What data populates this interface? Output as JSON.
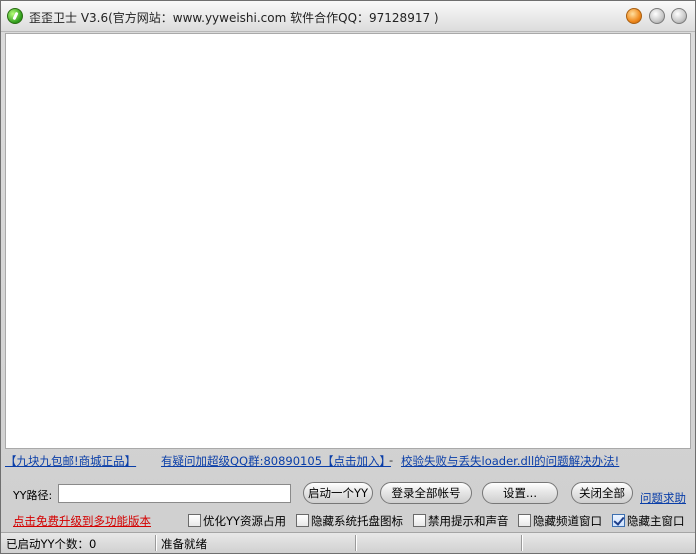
{
  "window": {
    "title": "歪歪卫士 V3.6(官方网站：www.yyweishi.com 软件合作QQ：97128917 )"
  },
  "links": {
    "promo": "【九块九包邮!商城正品】",
    "qq_group": "有疑问加超级QQ群:80890105【点击加入】",
    "dash": "-",
    "fix": "校验失败与丢失loader.dll的问题解决办法!",
    "help": "问题求助",
    "upgrade": "点击免费升级到多功能版本"
  },
  "path": {
    "label": "YY路径:",
    "value": ""
  },
  "buttons": {
    "launch_one": "启动一个YY",
    "login_all": "登录全部帐号",
    "settings": "设置...",
    "close_all": "关闭全部"
  },
  "options": [
    {
      "label": "优化YY资源占用",
      "checked": false
    },
    {
      "label": "隐藏系统托盘图标",
      "checked": false
    },
    {
      "label": "禁用提示和声音",
      "checked": false
    },
    {
      "label": "隐藏频道窗口",
      "checked": false
    },
    {
      "label": "隐藏主窗口",
      "checked": true
    }
  ],
  "status": {
    "count": "已启动YY个数：0",
    "state": "准备就绪"
  }
}
